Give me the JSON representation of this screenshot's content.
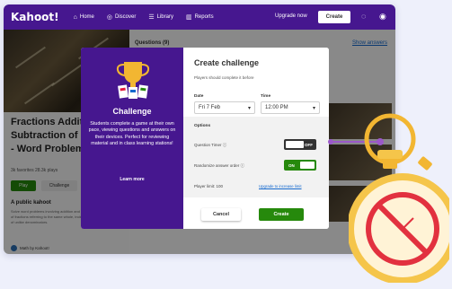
{
  "nav": {
    "logo": "Kahoot!",
    "items": [
      {
        "icon": "home-icon",
        "glyph": "⌂",
        "label": "Home"
      },
      {
        "icon": "compass-icon",
        "glyph": "◎",
        "label": "Discover"
      },
      {
        "icon": "library-icon",
        "glyph": "☰",
        "label": "Library"
      },
      {
        "icon": "reports-icon",
        "glyph": "▥",
        "label": "Reports"
      }
    ],
    "upgrade": "Upgrade now",
    "create": "Create",
    "bell_glyph": "◌",
    "user_glyph": "◉"
  },
  "background": {
    "quiz_title": "Fractions Addition and Subtraction of Fractions - Word Problems (MATH)",
    "meta": "3k favorites   28.3k plays",
    "play": "Play",
    "challenge": "Challenge",
    "public_label": "A public kahoot",
    "description": "Solve word problems involving addition and subtraction of fractions referring to the same whole, including cases of unlike denominators.",
    "author": "Math by Kahoot!",
    "questions_header": "Questions (9)",
    "show_answers": "Show answers"
  },
  "dialog": {
    "left": {
      "trophy_icon": "trophy-icon",
      "title": "Challenge",
      "text": "Students complete a game at their own pace, viewing questions and answers on their devices. Perfect for reviewing material and in class learning stations!",
      "learn_more": "Learn more"
    },
    "title": "Create challenge",
    "subtitle": "Players should complete it before",
    "date_label": "Date",
    "date_value": "Fri 7 Feb",
    "time_label": "Time",
    "time_value": "12:00 PM",
    "options_label": "Options",
    "question_timer_label": "Question Timer ⓘ",
    "question_timer_state": "OFF",
    "randomize_label": "Randomize answer order ⓘ",
    "randomize_state": "ON",
    "player_limit": "Player limit: 100",
    "upgrade_link": "Upgrade to increase limit",
    "cancel": "Cancel",
    "create": "Create"
  },
  "colors": {
    "brand_purple": "#46178f",
    "green": "#26890c",
    "accent_orange": "#f2b632",
    "stop_red": "#e2313f"
  },
  "stopwatch_icon": "stopwatch-no-timer-icon"
}
